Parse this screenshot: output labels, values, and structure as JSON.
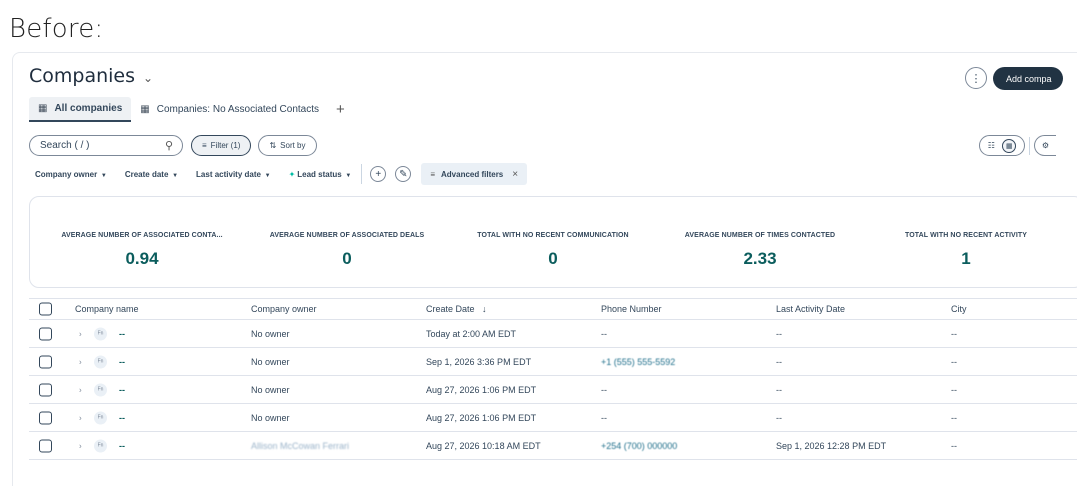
{
  "before_label": "Before:",
  "header": {
    "title": "Companies",
    "more_label": "⋮",
    "add_button": "Add compa"
  },
  "tabs": [
    {
      "label": "All companies"
    },
    {
      "label": "Companies: No Associated Contacts"
    }
  ],
  "tab_add": "+",
  "search": {
    "placeholder": "Search ( / )"
  },
  "toolbar": {
    "filter_label": "Filter (1)",
    "sort_label": "Sort by"
  },
  "quick_filters": [
    "Company owner",
    "Create date",
    "Last activity date",
    "Lead status"
  ],
  "advanced_filters": {
    "label": "Advanced filters",
    "close": "×"
  },
  "stats": [
    {
      "label": "AVERAGE NUMBER OF ASSOCIATED CONTA...",
      "value": "0.94"
    },
    {
      "label": "AVERAGE NUMBER OF ASSOCIATED DEALS",
      "value": "0"
    },
    {
      "label": "TOTAL WITH NO RECENT COMMUNICATION",
      "value": "0"
    },
    {
      "label": "AVERAGE NUMBER OF TIMES CONTACTED",
      "value": "2.33"
    },
    {
      "label": "TOTAL WITH NO RECENT ACTIVITY",
      "value": "1"
    }
  ],
  "table": {
    "columns": [
      "Company name",
      "Company owner",
      "Create Date",
      "Phone Number",
      "Last Activity Date",
      "City"
    ],
    "sort_indicator": "↓",
    "rows": [
      {
        "name": "--",
        "owner": "No owner",
        "create_date": "Today at 2:00 AM EDT",
        "phone": "--",
        "last_activity": "--",
        "city": "--"
      },
      {
        "name": "--",
        "owner": "No owner",
        "create_date": "Sep 1, 2026 3:36 PM EDT",
        "phone": "+1 (555) 555-5592",
        "last_activity": "--",
        "city": "--"
      },
      {
        "name": "--",
        "owner": "No owner",
        "create_date": "Aug 27, 2026 1:06 PM EDT",
        "phone": "--",
        "last_activity": "--",
        "city": "--"
      },
      {
        "name": "--",
        "owner": "No owner",
        "create_date": "Aug 27, 2026 1:06 PM EDT",
        "phone": "--",
        "last_activity": "--",
        "city": "--"
      },
      {
        "name": "--",
        "owner": "Allison McCowan Ferrari",
        "create_date": "Aug 27, 2026 10:18 AM EDT",
        "phone": "+254 (700) 000000",
        "last_activity": "Sep 1, 2026 12:28 PM EDT",
        "city": "--"
      }
    ]
  },
  "avatar_text": "Fn",
  "colors": {
    "accent_teal": "#0b5d5d",
    "dark_button": "#213343",
    "lead_bolt": "#00bda5"
  }
}
